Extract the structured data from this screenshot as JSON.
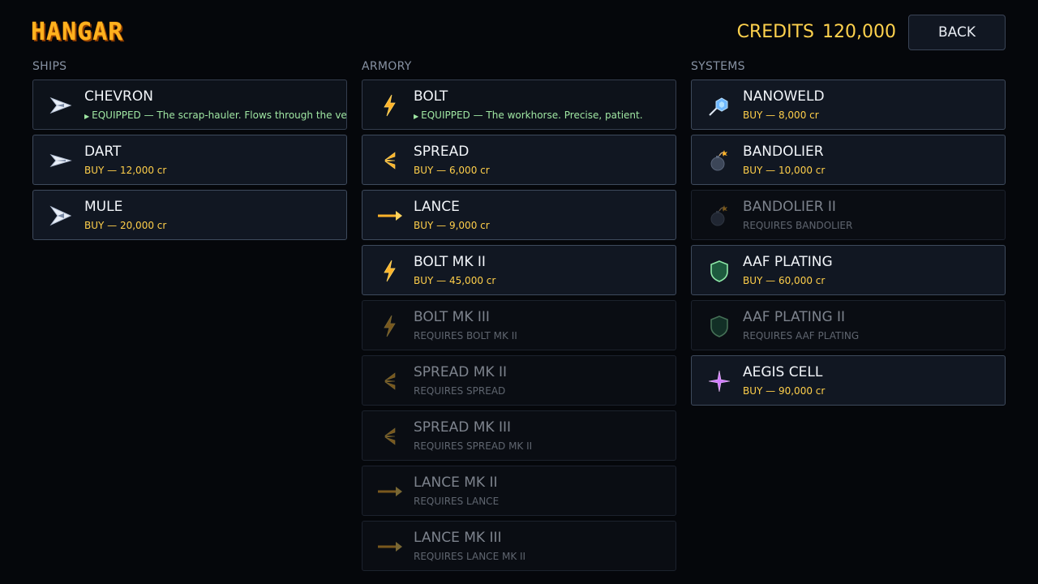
{
  "header": {
    "title": "HANGAR",
    "credits_label": "CREDITS",
    "credits_value": "120,000",
    "back_label": "BACK"
  },
  "ships": {
    "heading": "SHIPS",
    "items": [
      {
        "name": "CHEVRON",
        "status": "equipped",
        "sub": "EQUIPPED — The scrap-hauler. Flows through the vein",
        "icon": "chevron-ship-icon"
      },
      {
        "name": "DART",
        "status": "buy",
        "sub": "BUY — 12,000 cr",
        "icon": "dart-ship-icon"
      },
      {
        "name": "MULE",
        "status": "buy",
        "sub": "BUY — 20,000 cr",
        "icon": "mule-ship-icon"
      }
    ]
  },
  "armory": {
    "heading": "ARMORY",
    "items": [
      {
        "name": "BOLT",
        "status": "equipped",
        "sub": "EQUIPPED — The workhorse. Precise, patient.",
        "icon": "bolt-icon"
      },
      {
        "name": "SPREAD",
        "status": "buy",
        "sub": "BUY — 6,000 cr",
        "icon": "spread-icon"
      },
      {
        "name": "LANCE",
        "status": "buy",
        "sub": "BUY — 9,000 cr",
        "icon": "lance-icon"
      },
      {
        "name": "BOLT MK II",
        "status": "buy",
        "sub": "BUY — 45,000 cr",
        "icon": "bolt-icon"
      },
      {
        "name": "BOLT MK III",
        "status": "locked",
        "sub": "REQUIRES BOLT MK II",
        "icon": "bolt-icon"
      },
      {
        "name": "SPREAD MK II",
        "status": "locked",
        "sub": "REQUIRES SPREAD",
        "icon": "spread-icon"
      },
      {
        "name": "SPREAD MK III",
        "status": "locked",
        "sub": "REQUIRES SPREAD MK II",
        "icon": "spread-icon"
      },
      {
        "name": "LANCE MK II",
        "status": "locked",
        "sub": "REQUIRES LANCE",
        "icon": "lance-icon"
      },
      {
        "name": "LANCE MK III",
        "status": "locked",
        "sub": "REQUIRES LANCE MK II",
        "icon": "lance-icon"
      }
    ]
  },
  "systems": {
    "heading": "SYSTEMS",
    "items": [
      {
        "name": "NANOWELD",
        "status": "buy",
        "sub": "BUY — 8,000 cr",
        "icon": "nanoweld-icon"
      },
      {
        "name": "BANDOLIER",
        "status": "buy",
        "sub": "BUY — 10,000 cr",
        "icon": "bomb-icon"
      },
      {
        "name": "BANDOLIER II",
        "status": "locked",
        "sub": "REQUIRES BANDOLIER",
        "icon": "bomb-icon"
      },
      {
        "name": "AAF PLATING",
        "status": "buy",
        "sub": "BUY — 60,000 cr",
        "icon": "shield-icon"
      },
      {
        "name": "AAF PLATING II",
        "status": "locked",
        "sub": "REQUIRES AAF PLATING",
        "icon": "shield-icon"
      },
      {
        "name": "AEGIS CELL",
        "status": "buy",
        "sub": "BUY — 90,000 cr",
        "icon": "sparkle-icon"
      }
    ]
  },
  "colors": {
    "title": "#ffb21e",
    "credits": "#ffd24d",
    "buy": "#ffcf4a",
    "equipped": "#9fe6a2",
    "locked": "#5f656f"
  }
}
